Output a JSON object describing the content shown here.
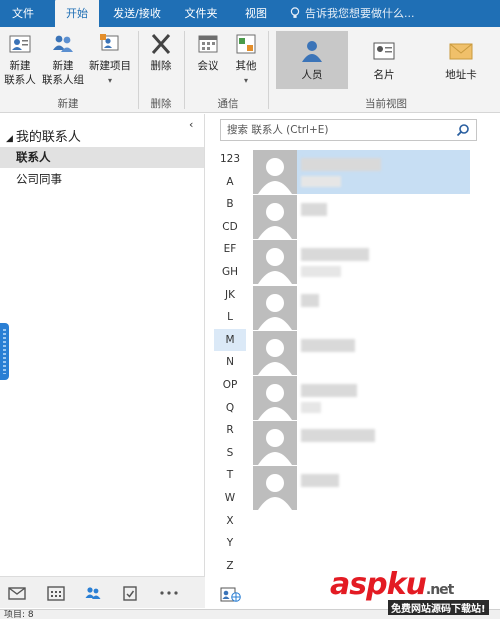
{
  "tabs": [
    "文件",
    "开始",
    "发送/接收",
    "文件夹",
    "视图"
  ],
  "tell_me": "告诉我您想要做什么...",
  "ribbon": {
    "new_contact": [
      "新建",
      "联系人"
    ],
    "new_group": [
      "新建",
      "联系人组"
    ],
    "new_items": "新建项目",
    "group_new": "新建",
    "delete": "删除",
    "group_delete": "删除",
    "meeting": "会议",
    "more": "其他",
    "group_comm": "通信",
    "view_people": "人员",
    "view_card": "名片",
    "view_address": "地址卡",
    "group_view": "当前视图"
  },
  "left": {
    "header": "我的联系人",
    "items": [
      "联系人",
      "公司同事"
    ]
  },
  "search": {
    "placeholder": "搜索 联系人 (Ctrl+E)"
  },
  "az_index": [
    "123",
    "A",
    "B",
    "CD",
    "EF",
    "GH",
    "JK",
    "L",
    "M",
    "N",
    "OP",
    "Q",
    "R",
    "S",
    "T",
    "W",
    "X",
    "Y",
    "Z"
  ],
  "az_selected": "M",
  "contacts_visible": 8,
  "status": "项目: 8",
  "watermark": {
    "main": "aspku",
    "suffix": ".net",
    "sub": "免费网站源码下载站!"
  },
  "colors": {
    "tab_bar": "#1f6fb5",
    "selected_row": "#c7def3",
    "accent": "#2a7fd4"
  }
}
